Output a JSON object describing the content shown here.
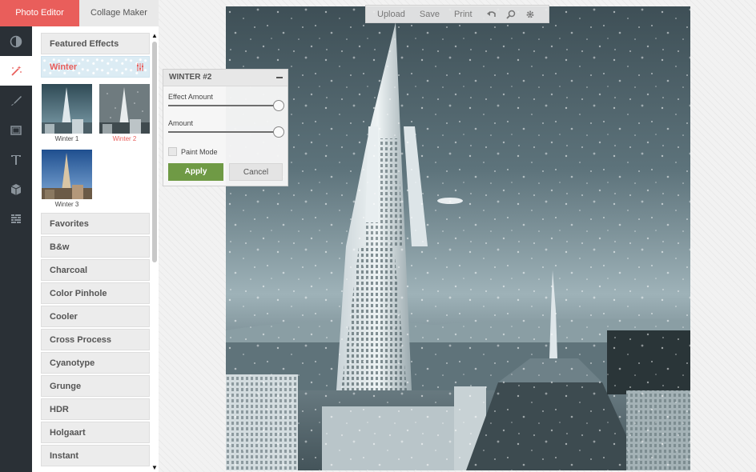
{
  "tabs": [
    {
      "label": "Photo Editor",
      "active": true
    },
    {
      "label": "Collage Maker",
      "active": false
    }
  ],
  "rail": [
    {
      "icon": "adjust-icon",
      "active": false
    },
    {
      "icon": "magic-wand-icon",
      "active": true
    },
    {
      "icon": "brush-icon",
      "active": false
    },
    {
      "icon": "frame-icon",
      "active": false
    },
    {
      "icon": "text-icon",
      "active": false
    },
    {
      "icon": "cube-icon",
      "active": false
    },
    {
      "icon": "texture-icon",
      "active": false
    }
  ],
  "effects": {
    "featured_label": "Featured Effects",
    "selected_label": "Winter",
    "thumbnails": [
      {
        "label": "Winter 1",
        "active": false
      },
      {
        "label": "Winter 2",
        "active": true
      },
      {
        "label": "Winter 3",
        "active": false
      }
    ],
    "categories": [
      "Favorites",
      "B&w",
      "Charcoal",
      "Color Pinhole",
      "Cooler",
      "Cross Process",
      "Cyanotype",
      "Grunge",
      "HDR",
      "Holgaart",
      "Instant"
    ]
  },
  "toolbar": {
    "upload_label": "Upload",
    "save_label": "Save",
    "print_label": "Print",
    "icons": [
      "undo-icon",
      "zoom-icon",
      "settings-icon"
    ]
  },
  "dialog": {
    "title": "WINTER #2",
    "effect_amount_label": "Effect Amount",
    "effect_amount_value": 1.0,
    "amount_label": "Amount",
    "amount_value": 1.0,
    "paint_mode_label": "Paint Mode",
    "paint_mode_checked": false,
    "apply_label": "Apply",
    "cancel_label": "Cancel"
  },
  "colors": {
    "accent": "#e95e5b",
    "apply_green": "#6f9a45",
    "rail_bg": "#2a3036"
  }
}
